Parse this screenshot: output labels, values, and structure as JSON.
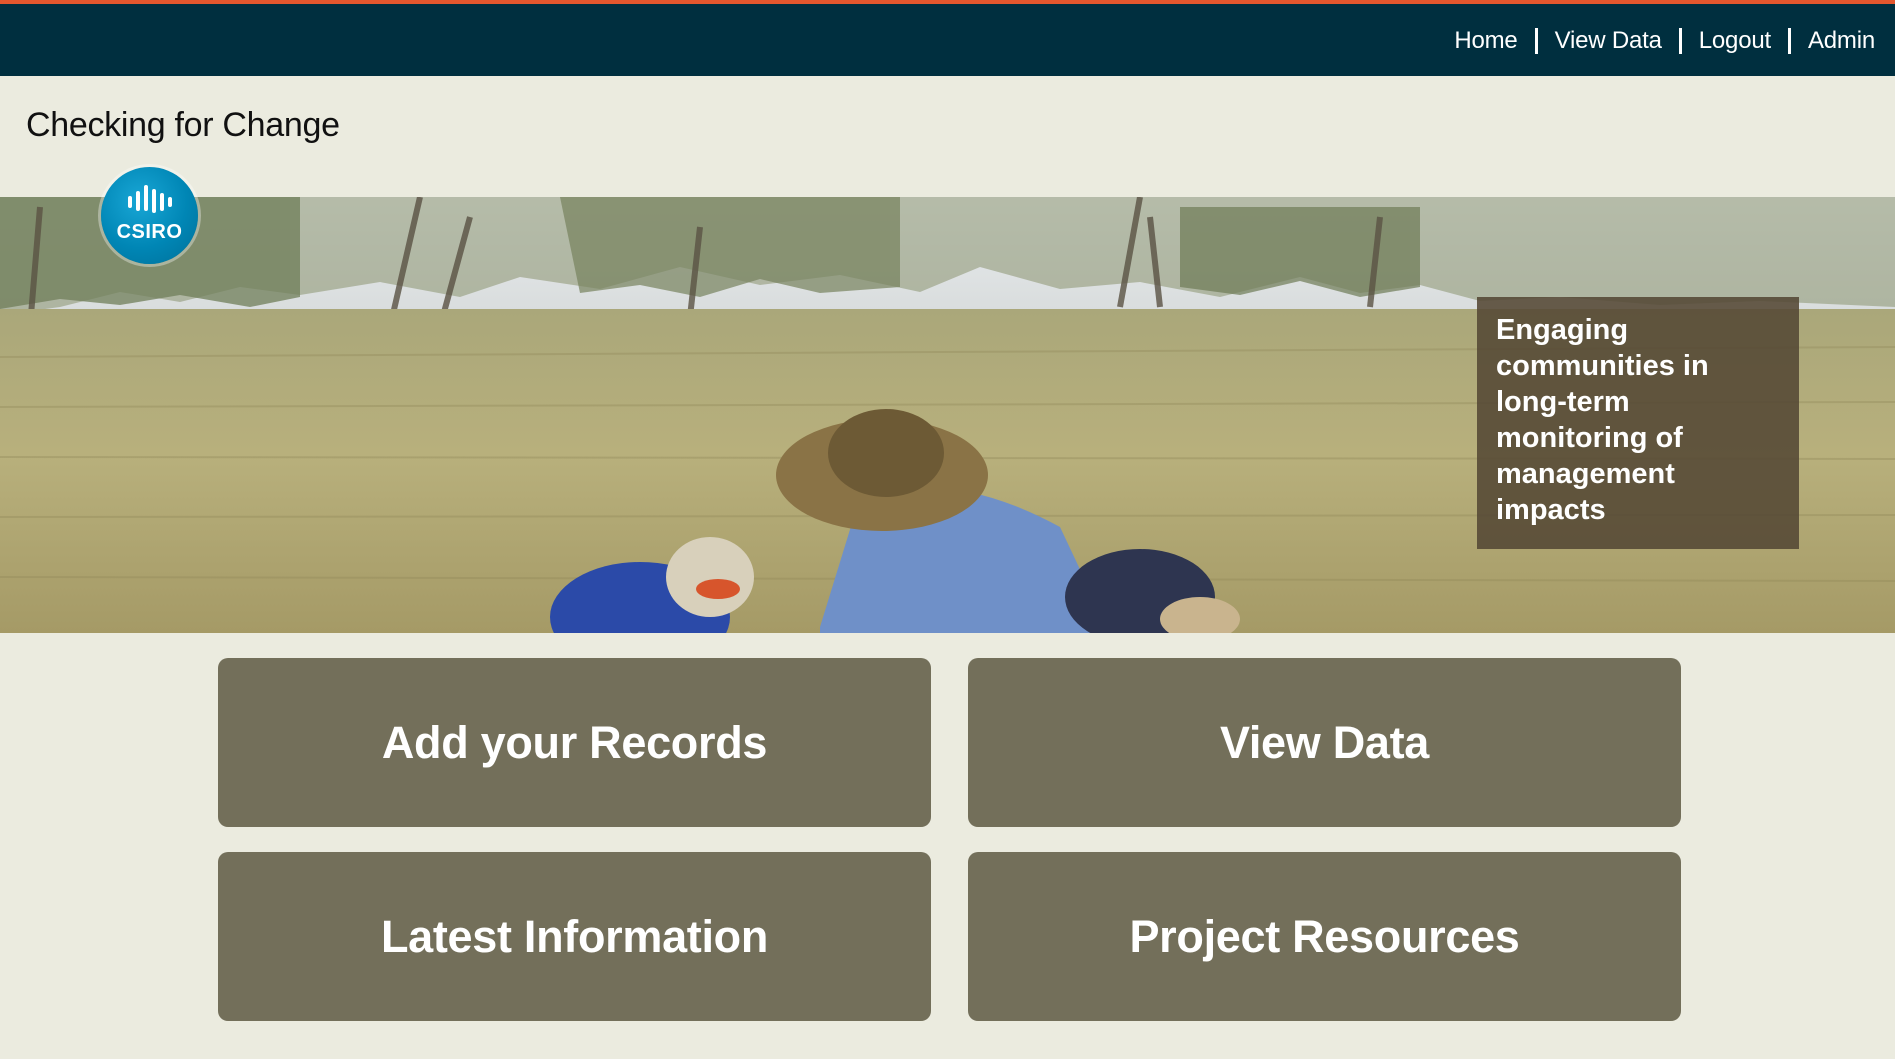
{
  "nav": {
    "items": [
      {
        "label": "Home"
      },
      {
        "label": "View Data"
      },
      {
        "label": "Logout"
      },
      {
        "label": "Admin"
      }
    ]
  },
  "site": {
    "title": "Checking for Change"
  },
  "logo": {
    "text": "CSIRO",
    "icon": "csiro-logo"
  },
  "hero": {
    "caption": "Engaging communities in long-term monitoring of management impacts"
  },
  "tiles": [
    {
      "label": "Add your Records"
    },
    {
      "label": "View Data"
    },
    {
      "label": "Latest Information"
    },
    {
      "label": "Project Resources"
    }
  ],
  "colors": {
    "nav_background": "#002f3f",
    "nav_accent": "#e4572e",
    "page_background": "#ebebdf",
    "tile_background": "#736f5a",
    "logo_blue": "#0086b5"
  }
}
